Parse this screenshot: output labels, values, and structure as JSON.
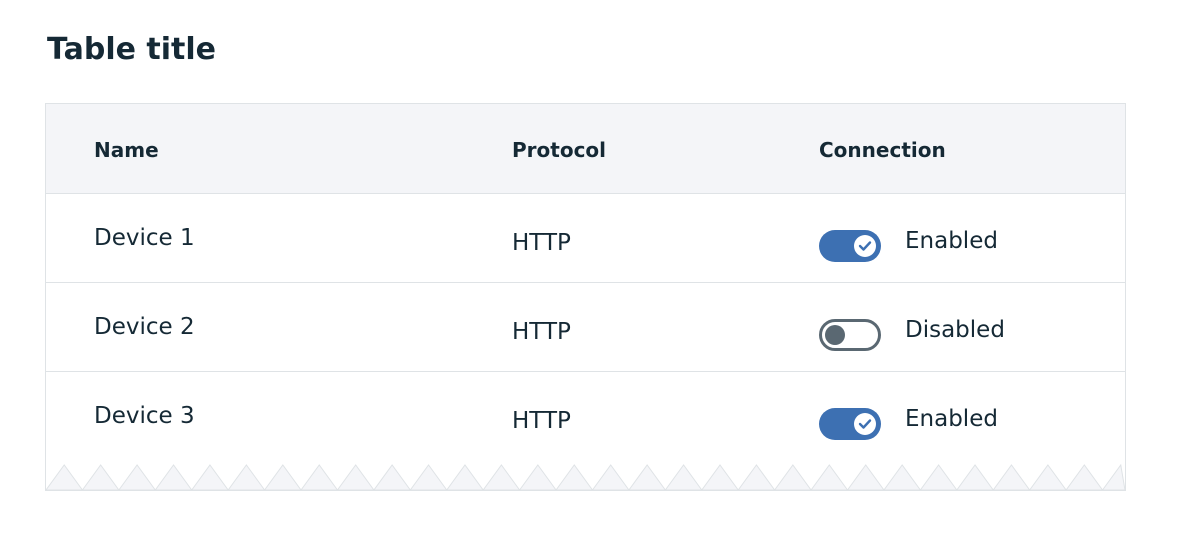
{
  "table": {
    "title": "Table title",
    "headers": {
      "name": "Name",
      "protocol": "Protocol",
      "connection": "Connection"
    },
    "rows": [
      {
        "name": "Device 1",
        "protocol": "HTTP",
        "connection_enabled": true,
        "connection_label": "Enabled"
      },
      {
        "name": "Device 2",
        "protocol": "HTTP",
        "connection_enabled": false,
        "connection_label": "Disabled"
      },
      {
        "name": "Device 3",
        "protocol": "HTTP",
        "connection_enabled": true,
        "connection_label": "Enabled"
      }
    ]
  },
  "colors": {
    "toggle_on": "#3d70b2",
    "toggle_off": "#5a6872",
    "header_bg": "#f4f5f8",
    "border": "#dfe3e6",
    "text": "#152935"
  },
  "icons": {
    "toggle_check": "checkmark-icon",
    "truncation": "zigzag-edge"
  }
}
